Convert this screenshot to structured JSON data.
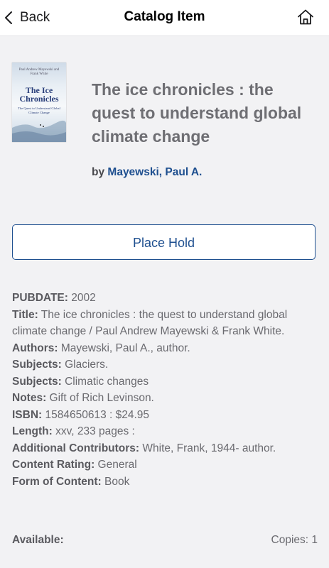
{
  "nav": {
    "back_label": "Back",
    "title": "Catalog Item",
    "back_icon": "chevron-left-icon",
    "home_icon": "home-icon"
  },
  "cover": {
    "authors": "Paul Andrew Mayewski and Frank White",
    "title": "The Ice Chronicles",
    "subtitle": "The Quest to Understand Global Climate Change"
  },
  "item": {
    "title": "The ice chronicles : the quest to understand global climate change",
    "by_label": "by",
    "author": "Mayewski, Paul A."
  },
  "actions": {
    "place_hold_label": "Place Hold"
  },
  "details": [
    {
      "label": "PUBDATE:",
      "value": "2002"
    },
    {
      "label": "Title:",
      "value": "The ice chronicles : the quest to understand global climate change / Paul Andrew Mayewski & Frank White."
    },
    {
      "label": "Authors:",
      "value": "Mayewski, Paul A., author."
    },
    {
      "label": "Subjects:",
      "value": "Glaciers."
    },
    {
      "label": "Subjects:",
      "value": "Climatic changes"
    },
    {
      "label": "Notes:",
      "value": "Gift of Rich Levinson."
    },
    {
      "label": "ISBN:",
      "value": "1584650613 : $24.95"
    },
    {
      "label": "Length:",
      "value": "xxv, 233 pages :"
    },
    {
      "label": "Additional Contributors:",
      "value": "White, Frank, 1944- author."
    },
    {
      "label": "Content Rating:",
      "value": "General"
    },
    {
      "label": "Form of Content:",
      "value": "Book"
    }
  ],
  "availability": {
    "label": "Available:",
    "copies": "Copies: 1"
  },
  "colors": {
    "accent": "#1e4f8f",
    "background": "#f2f2f4",
    "nav_background": "#ffffff"
  }
}
